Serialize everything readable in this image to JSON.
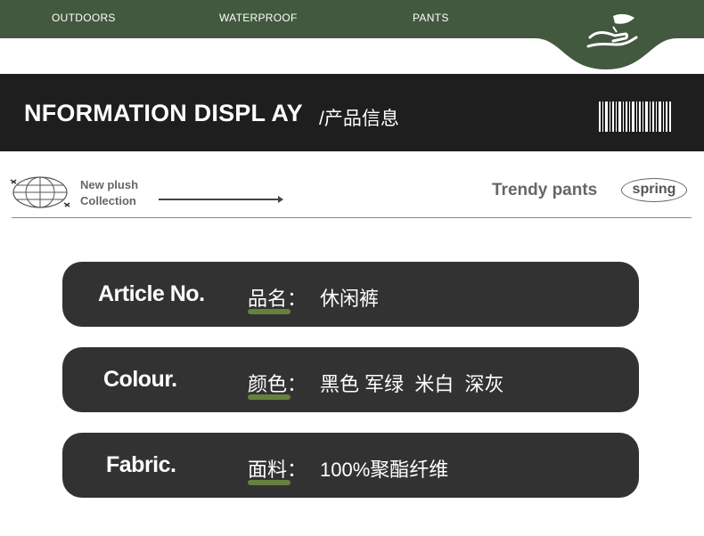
{
  "nav": {
    "items": [
      "OUTDOORS",
      "WATERPROOF",
      "PANTS"
    ],
    "logo_icon": "hand-leaf-icon",
    "color": "#43593f"
  },
  "info_bar": {
    "title": "NFORMATION DISPL AY",
    "subtitle": "/产品信息",
    "barcode_icon": "barcode-icon"
  },
  "collection": {
    "globe_icon": "globe-icon",
    "line1": "New plush",
    "line2": "Collection",
    "trendy": "Trendy pants",
    "tag": "spring"
  },
  "cards": [
    {
      "label": "Article No.",
      "key": "品名：",
      "value": "休闲裤"
    },
    {
      "label": "Colour.",
      "key": "颜色：",
      "value": "黑色 军绿  米白  深灰"
    },
    {
      "label": "Fabric.",
      "key": "面料：",
      "value": "100%聚酯纤维"
    }
  ],
  "accent_color": "#6b8a3e"
}
